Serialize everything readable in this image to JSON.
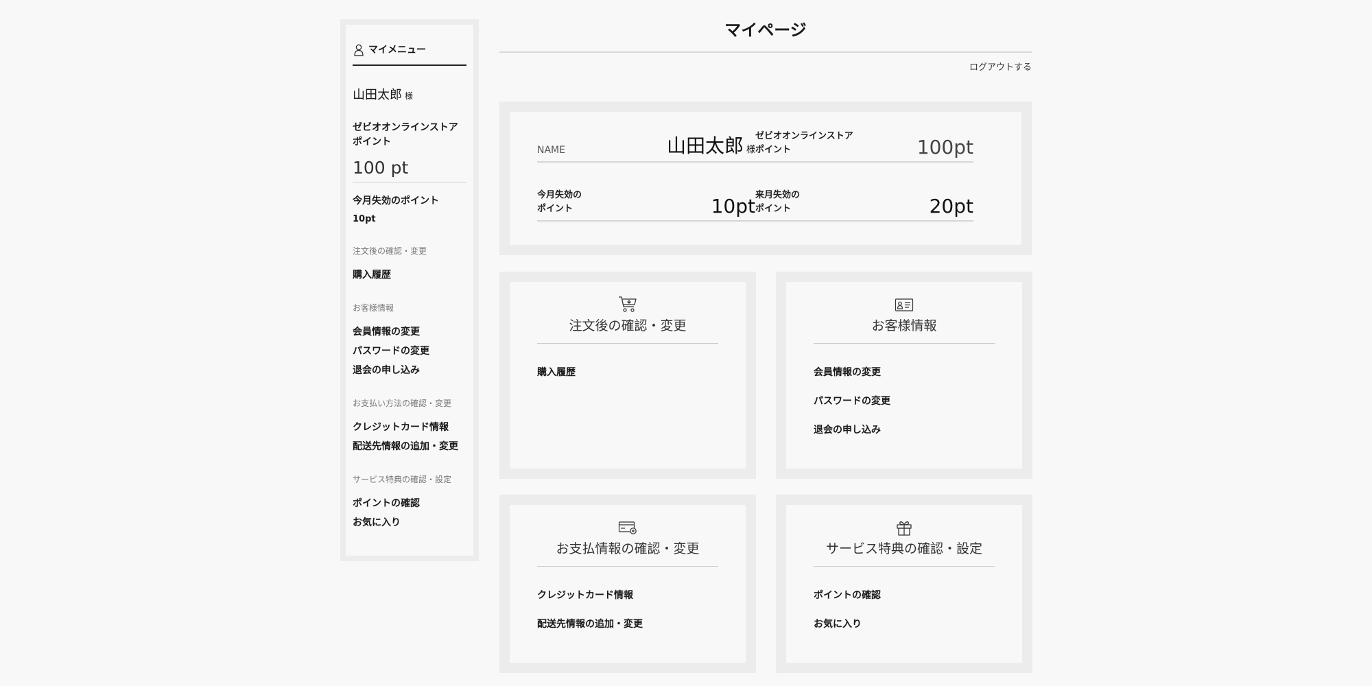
{
  "sidebar": {
    "title": "マイメニュー",
    "user_name": "山田太郎",
    "honorific": "様",
    "store_line1": "ゼビオオンラインストア",
    "store_line2": "ポイント",
    "points": "100 pt",
    "expiring_label": "今月失効のポイント",
    "expiring_value": "10pt",
    "sections": [
      {
        "title": "注文後の確認・変更",
        "links": [
          "購入履歴"
        ]
      },
      {
        "title": "お客様情報",
        "links": [
          "会員情報の変更",
          "パスワードの変更",
          "退会の申し込み"
        ]
      },
      {
        "title": "お支払い方法の確認・変更",
        "links": [
          "クレジットカード情報",
          "配送先情報の追加・変更"
        ]
      },
      {
        "title": "サービス特典の確認・設定",
        "links": [
          "ポイントの確認",
          "お気に入り"
        ]
      }
    ]
  },
  "header": {
    "title": "マイページ",
    "logout": "ログアウトする"
  },
  "summary": {
    "name_label": "NAME",
    "name_value": "山田太郎",
    "honorific": "様",
    "store_line1": "ゼビオオンラインストア",
    "store_line2": "ポイント",
    "store_points": "100pt",
    "this_month_line1": "今月失効の",
    "this_month_line2": "ポイント",
    "this_month_value": "10pt",
    "next_month_line1": "来月失効の",
    "next_month_line2": "ポイント",
    "next_month_value": "20pt"
  },
  "cards": [
    {
      "icon": "cart-icon",
      "title": "注文後の確認・変更",
      "links": [
        "購入履歴"
      ]
    },
    {
      "icon": "id-card-icon",
      "title": "お客様情報",
      "links": [
        "会員情報の変更",
        "パスワードの変更",
        "退会の申し込み"
      ]
    },
    {
      "icon": "credit-card-icon",
      "title": "お支払情報の確認・変更",
      "links": [
        "クレジットカード情報",
        "配送先情報の追加・変更"
      ]
    },
    {
      "icon": "gift-icon",
      "title": "サービス特典の確認・設定",
      "links": [
        "ポイントの確認",
        "お気に入り"
      ]
    }
  ]
}
